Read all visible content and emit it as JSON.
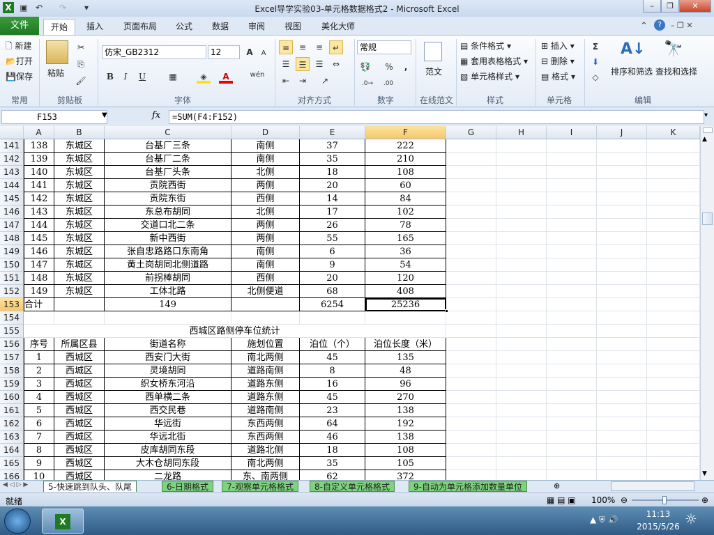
{
  "window": {
    "title": "Excel导学实验03-单元格数据格式2 - Microsoft Excel"
  },
  "ribbon": {
    "file_tab": "文件",
    "tabs": [
      "开始",
      "插入",
      "页面布局",
      "公式",
      "数据",
      "审阅",
      "视图",
      "美化大师"
    ],
    "clipboard": {
      "new": "新建",
      "open": "打开",
      "save": "保存",
      "paste": "粘贴",
      "group1": "常用",
      "group2": "剪贴板"
    },
    "font": {
      "name": "仿宋_GB2312",
      "size": "12",
      "bold": "B",
      "italic": "I",
      "underline": "U",
      "grow": "A",
      "shrink": "A",
      "wen": "wén",
      "group": "字体"
    },
    "align": {
      "group": "对齐方式"
    },
    "number": {
      "format": "常规",
      "percent": "%",
      "comma": ",",
      "group": "数字"
    },
    "online": {
      "label": "范文",
      "group": "在线范文"
    },
    "styles": {
      "cond": "条件格式",
      "table": "套用表格格式",
      "cell": "单元格样式",
      "group": "样式"
    },
    "cells": {
      "insert": "插入",
      "delete": "删除",
      "format": "格式",
      "group": "单元格"
    },
    "editing": {
      "sigma": "Σ",
      "sort": "排序和筛选",
      "find": "查找和选择",
      "group": "编辑"
    }
  },
  "formula_bar": {
    "name_box": "F153",
    "fx": "fx",
    "formula": "=SUM(F4:F152)"
  },
  "columns": [
    "A",
    "B",
    "C",
    "D",
    "E",
    "F",
    "G",
    "H",
    "I",
    "J",
    "K"
  ],
  "rows": [
    {
      "n": "141",
      "c": [
        "138",
        "东城区",
        "台基厂三条",
        "南侧",
        "37",
        "222"
      ]
    },
    {
      "n": "142",
      "c": [
        "139",
        "东城区",
        "台基厂二条",
        "南侧",
        "35",
        "210"
      ]
    },
    {
      "n": "143",
      "c": [
        "140",
        "东城区",
        "台基厂头条",
        "北侧",
        "18",
        "108"
      ]
    },
    {
      "n": "144",
      "c": [
        "141",
        "东城区",
        "贡院西街",
        "两侧",
        "20",
        "60"
      ]
    },
    {
      "n": "145",
      "c": [
        "142",
        "东城区",
        "贡院东街",
        "西侧",
        "14",
        "84"
      ]
    },
    {
      "n": "146",
      "c": [
        "143",
        "东城区",
        "东总布胡同",
        "北侧",
        "17",
        "102"
      ]
    },
    {
      "n": "147",
      "c": [
        "144",
        "东城区",
        "交道口北二条",
        "两侧",
        "26",
        "78"
      ]
    },
    {
      "n": "148",
      "c": [
        "145",
        "东城区",
        "新中西街",
        "两侧",
        "55",
        "165"
      ]
    },
    {
      "n": "149",
      "c": [
        "146",
        "东城区",
        "张自忠路路口东南角",
        "南侧",
        "6",
        "36"
      ]
    },
    {
      "n": "150",
      "c": [
        "147",
        "东城区",
        "黄土岗胡同北侧道路",
        "南侧",
        "9",
        "54"
      ]
    },
    {
      "n": "151",
      "c": [
        "148",
        "东城区",
        "前拐棒胡同",
        "西侧",
        "20",
        "120"
      ]
    },
    {
      "n": "152",
      "c": [
        "149",
        "东城区",
        "工体北路",
        "北侧便道",
        "68",
        "408"
      ]
    },
    {
      "n": "153",
      "c": [
        "合计",
        "",
        "149",
        "",
        "6254",
        "25236"
      ]
    },
    {
      "n": "154",
      "c": [
        "",
        "",
        "",
        "",
        "",
        ""
      ]
    },
    {
      "n": "155",
      "c": [
        "",
        "",
        "西城区路侧停车位统计",
        "",
        "",
        ""
      ]
    },
    {
      "n": "156",
      "c": [
        "序号",
        "所属区县",
        "街道名称",
        "施划位置",
        "泊位（个）",
        "泊位长度（米）"
      ]
    },
    {
      "n": "157",
      "c": [
        "1",
        "西城区",
        "西安门大街",
        "南北两侧",
        "45",
        "135"
      ]
    },
    {
      "n": "158",
      "c": [
        "2",
        "西城区",
        "灵境胡同",
        "道路南侧",
        "8",
        "48"
      ]
    },
    {
      "n": "159",
      "c": [
        "3",
        "西城区",
        "织女桥东河沿",
        "道路东侧",
        "16",
        "96"
      ]
    },
    {
      "n": "160",
      "c": [
        "4",
        "西城区",
        "西单横二条",
        "道路东侧",
        "45",
        "270"
      ]
    },
    {
      "n": "161",
      "c": [
        "5",
        "西城区",
        "西交民巷",
        "道路南侧",
        "23",
        "138"
      ]
    },
    {
      "n": "162",
      "c": [
        "6",
        "西城区",
        "华远街",
        "东西两侧",
        "64",
        "192"
      ]
    },
    {
      "n": "163",
      "c": [
        "7",
        "西城区",
        "华远北街",
        "东西两侧",
        "46",
        "138"
      ]
    },
    {
      "n": "164",
      "c": [
        "8",
        "西城区",
        "皮库胡同东段",
        "道路北侧",
        "18",
        "108"
      ]
    },
    {
      "n": "165",
      "c": [
        "9",
        "西城区",
        "大木仓胡同东段",
        "南北两侧",
        "35",
        "105"
      ]
    },
    {
      "n": "166",
      "c": [
        "10",
        "西城区",
        "二龙路",
        "东、南两侧",
        "62",
        "372"
      ]
    }
  ],
  "sheet_tabs": [
    "5-快速跳到队头、队尾",
    "6-日期格式",
    "7-观察单元格格式",
    "8-自定义单元格格式",
    "9-自动为单元格添加数量单位"
  ],
  "status": {
    "ready": "就绪",
    "zoom": "100%"
  },
  "taskbar": {
    "time": "11:13",
    "date": "2015/5/26"
  }
}
